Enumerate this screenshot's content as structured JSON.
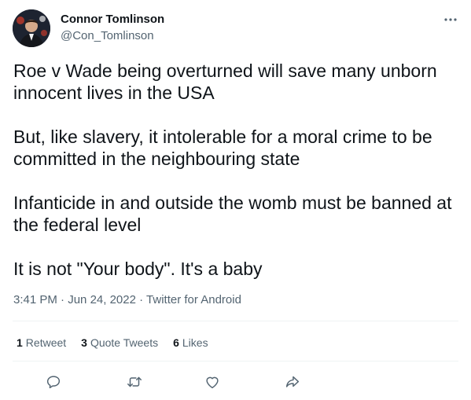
{
  "author": {
    "display_name": "Connor Tomlinson",
    "handle": "@Con_Tomlinson",
    "avatar_icon": "profile-photo"
  },
  "tweet": {
    "paragraphs": [
      "Roe v Wade being overturned will save many unborn innocent lives in the USA",
      "But, like slavery, it intolerable for a moral crime to be committed in the neighbouring state",
      "Infanticide in and outside the womb must be banned at the federal level",
      "It is not \"Your body\". It's a baby"
    ],
    "time": "3:41 PM",
    "separator": " · ",
    "date": "Jun 24, 2022",
    "source": "Twitter for Android"
  },
  "stats": {
    "retweets": {
      "count": "1",
      "label": "Retweet"
    },
    "quotes": {
      "count": "3",
      "label": "Quote Tweets"
    },
    "likes": {
      "count": "6",
      "label": "Likes"
    }
  },
  "actions": {
    "reply_icon": "reply-icon",
    "retweet_icon": "retweet-icon",
    "like_icon": "like-icon",
    "share_icon": "share-icon"
  },
  "colors": {
    "text": "#0f1419",
    "secondary": "#536471",
    "divider": "#eff3f4"
  }
}
